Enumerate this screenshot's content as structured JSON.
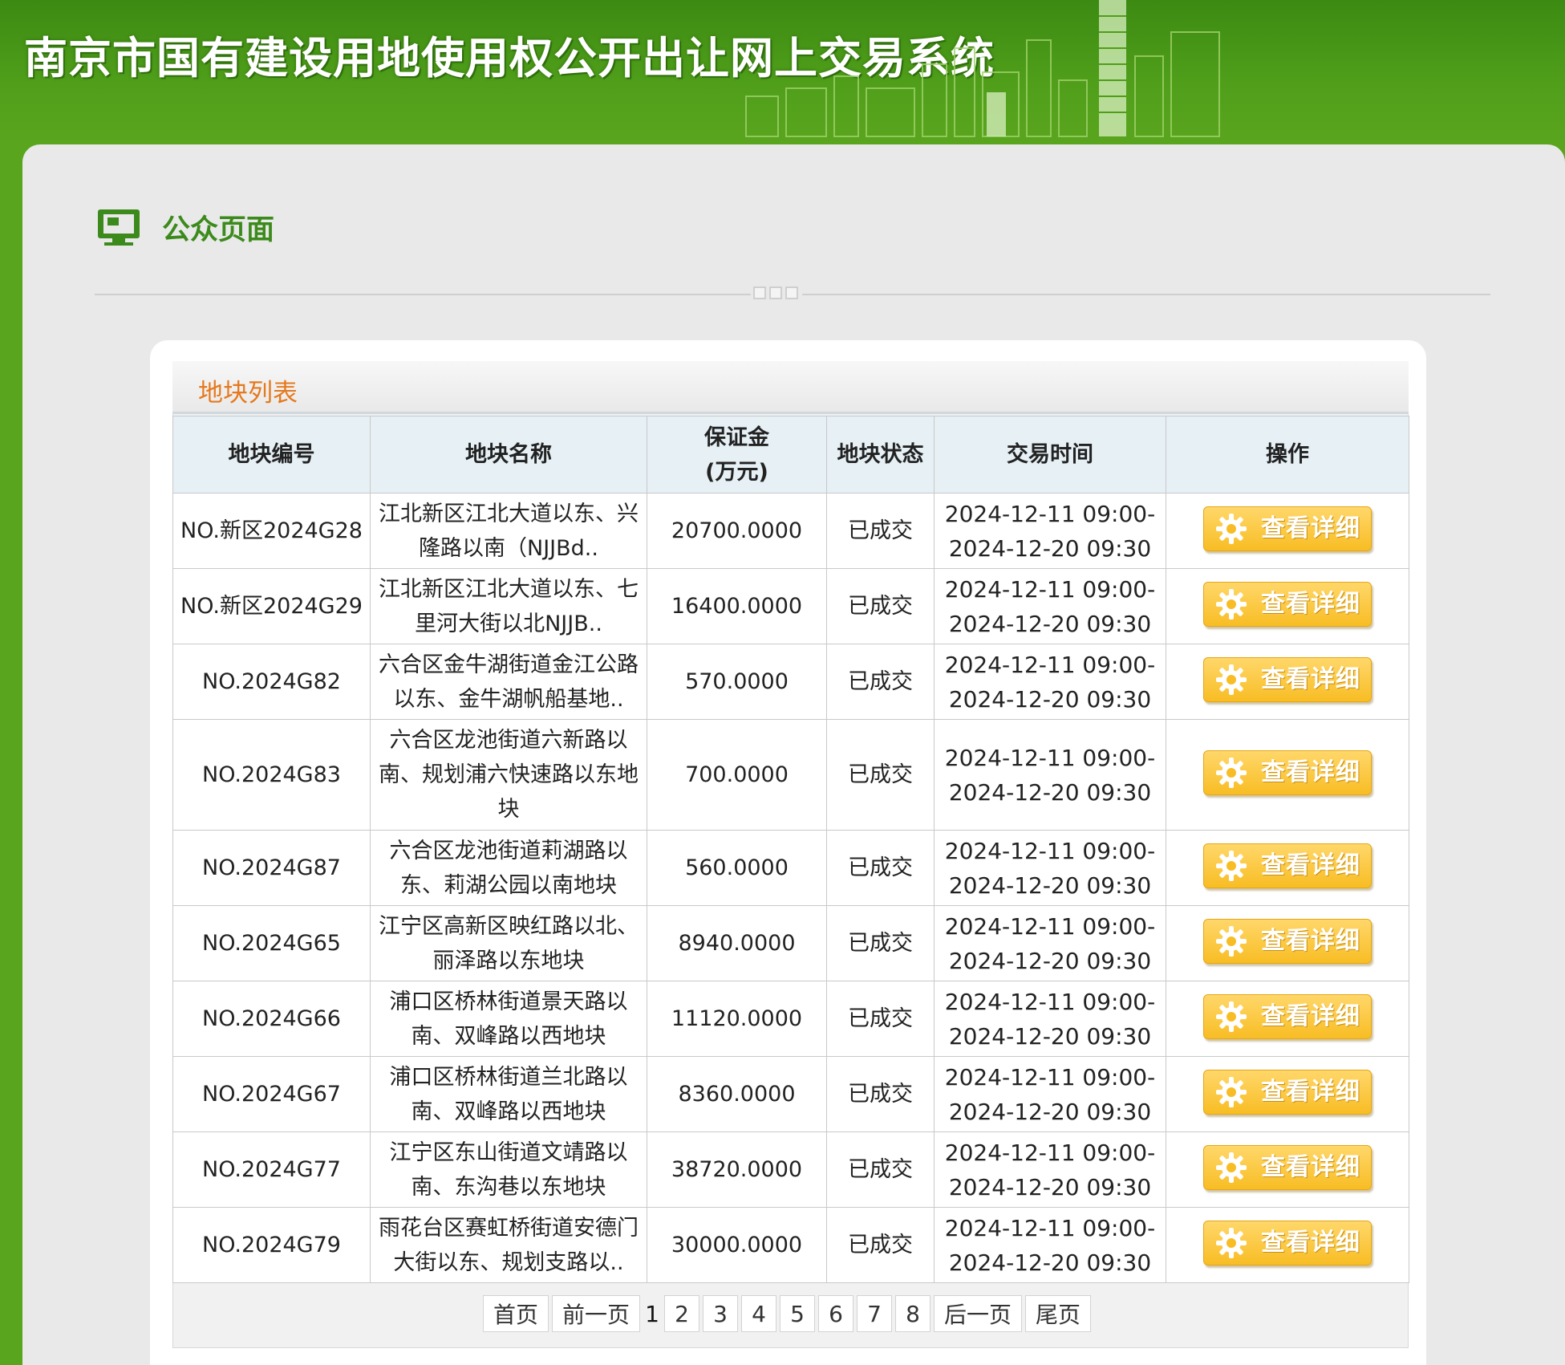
{
  "header": {
    "title": "南京市国有建设用地使用权公开出让网上交易系统"
  },
  "section": {
    "title": "公众页面",
    "icon": "monitor-icon"
  },
  "list": {
    "title": "地块列表",
    "columns": [
      "地块编号",
      "地块名称",
      "保证金",
      "(万元)",
      "地块状态",
      "交易时间",
      "操作"
    ],
    "rows": [
      {
        "id": "NO.新区2024G28",
        "name1": "江北新区江北大道以东、兴",
        "name2": "隆路以南（NJJBd..",
        "name3": "",
        "deposit": "20700.0000",
        "status": "已成交",
        "time1": "2024-12-11 09:00-",
        "time2": "2024-12-20 09:30",
        "action": "查看详细"
      },
      {
        "id": "NO.新区2024G29",
        "name1": "江北新区江北大道以东、七",
        "name2": "里河大街以北NJJB..",
        "name3": "",
        "deposit": "16400.0000",
        "status": "已成交",
        "time1": "2024-12-11 09:00-",
        "time2": "2024-12-20 09:30",
        "action": "查看详细"
      },
      {
        "id": "NO.2024G82",
        "name1": "六合区金牛湖街道金江公路",
        "name2": "以东、金牛湖帆船基地..",
        "name3": "",
        "deposit": "570.0000",
        "status": "已成交",
        "time1": "2024-12-11 09:00-",
        "time2": "2024-12-20 09:30",
        "action": "查看详细"
      },
      {
        "id": "NO.2024G83",
        "name1": "六合区龙池街道六新路以",
        "name2": "南、规划浦六快速路以东地",
        "name3": "块",
        "deposit": "700.0000",
        "status": "已成交",
        "time1": "2024-12-11 09:00-",
        "time2": "2024-12-20 09:30",
        "action": "查看详细"
      },
      {
        "id": "NO.2024G87",
        "name1": "六合区龙池街道莉湖路以",
        "name2": "东、莉湖公园以南地块",
        "name3": "",
        "deposit": "560.0000",
        "status": "已成交",
        "time1": "2024-12-11 09:00-",
        "time2": "2024-12-20 09:30",
        "action": "查看详细"
      },
      {
        "id": "NO.2024G65",
        "name1": "江宁区高新区映红路以北、",
        "name2": "丽泽路以东地块",
        "name3": "",
        "deposit": "8940.0000",
        "status": "已成交",
        "time1": "2024-12-11 09:00-",
        "time2": "2024-12-20 09:30",
        "action": "查看详细"
      },
      {
        "id": "NO.2024G66",
        "name1": "浦口区桥林街道景天路以",
        "name2": "南、双峰路以西地块",
        "name3": "",
        "deposit": "11120.0000",
        "status": "已成交",
        "time1": "2024-12-11 09:00-",
        "time2": "2024-12-20 09:30",
        "action": "查看详细"
      },
      {
        "id": "NO.2024G67",
        "name1": "浦口区桥林街道兰北路以",
        "name2": "南、双峰路以西地块",
        "name3": "",
        "deposit": "8360.0000",
        "status": "已成交",
        "time1": "2024-12-11 09:00-",
        "time2": "2024-12-20 09:30",
        "action": "查看详细"
      },
      {
        "id": "NO.2024G77",
        "name1": "江宁区东山街道文靖路以",
        "name2": "南、东沟巷以东地块",
        "name3": "",
        "deposit": "38720.0000",
        "status": "已成交",
        "time1": "2024-12-11 09:00-",
        "time2": "2024-12-20 09:30",
        "action": "查看详细"
      },
      {
        "id": "NO.2024G79",
        "name1": "雨花台区赛虹桥街道安德门",
        "name2": "大街以东、规划支路以..",
        "name3": "",
        "deposit": "30000.0000",
        "status": "已成交",
        "time1": "2024-12-11 09:00-",
        "time2": "2024-12-20 09:30",
        "action": "查看详细"
      }
    ]
  },
  "pagination": {
    "first": "首页",
    "prev": "前一页",
    "current": "1",
    "pages": [
      "2",
      "3",
      "4",
      "5",
      "6",
      "7",
      "8"
    ],
    "next": "后一页",
    "last": "尾页"
  },
  "colors": {
    "brand_green": "#5aa51e",
    "heading_orange": "#e5791d",
    "button_yellow": "#f8bd24"
  }
}
